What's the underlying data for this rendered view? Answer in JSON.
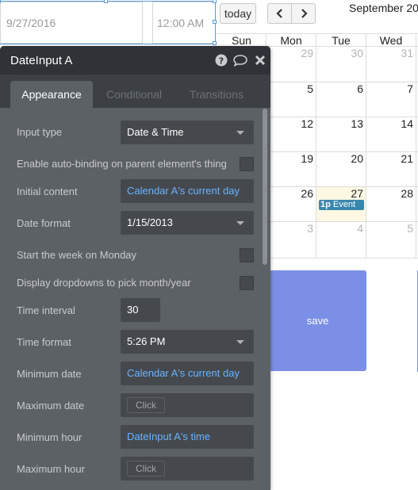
{
  "date_input": {
    "value": "9/27/2016"
  },
  "time_input": {
    "value": "12:00 AM"
  },
  "calendar": {
    "today_label": "today",
    "title": "September 20",
    "weekdays": [
      "Sun",
      "Mon",
      "Tue",
      "Wed"
    ],
    "weeks": [
      [
        "",
        "29",
        "30",
        "31"
      ],
      [
        "",
        "5",
        "6",
        "7"
      ],
      [
        "",
        "12",
        "13",
        "14"
      ],
      [
        "",
        "19",
        "20",
        "21"
      ],
      [
        "26",
        "",
        "27",
        "28"
      ],
      [
        "",
        "3",
        "4",
        "5"
      ]
    ],
    "event": {
      "time": "1p",
      "title": "Event"
    }
  },
  "save_button": {
    "label": "save"
  },
  "panel": {
    "title": "DateInput A",
    "tabs": [
      "Appearance",
      "Conditional",
      "Transitions"
    ],
    "fields": {
      "input_type": {
        "label": "Input type",
        "value": "Date & Time"
      },
      "auto_binding": {
        "label": "Enable auto-binding on parent element's thing",
        "checked": false
      },
      "initial_content": {
        "label": "Initial content",
        "value": "Calendar A's current day"
      },
      "date_format": {
        "label": "Date format",
        "value": "1/15/2013"
      },
      "week_monday": {
        "label": "Start the week on Monday",
        "checked": false
      },
      "dropdowns": {
        "label": "Display dropdowns to pick month/year",
        "checked": false
      },
      "time_interval": {
        "label": "Time interval",
        "value": "30"
      },
      "time_format": {
        "label": "Time format",
        "value": "5:26 PM"
      },
      "minimum_date": {
        "label": "Minimum date",
        "value": "Calendar A's current day"
      },
      "maximum_date": {
        "label": "Maximum date",
        "placeholder": "Click"
      },
      "minimum_hour": {
        "label": "Minimum hour",
        "value": "DateInput A's time"
      },
      "maximum_hour": {
        "label": "Maximum hour",
        "placeholder": "Click"
      }
    }
  },
  "colors": {
    "panel_bg": "#5c6166",
    "header_bg": "#2f3337",
    "dynamic_text": "#6ab3ff",
    "save_button": "#7b8fe6",
    "event_bg": "#3a87ad",
    "today_bg": "#fcf8e3",
    "selection": "#5a9bd8"
  },
  "icons": {
    "help": "question-circle-icon",
    "comment": "speech-bubble-icon",
    "close": "close-icon",
    "prev": "chevron-left-icon",
    "next": "chevron-right-icon"
  }
}
